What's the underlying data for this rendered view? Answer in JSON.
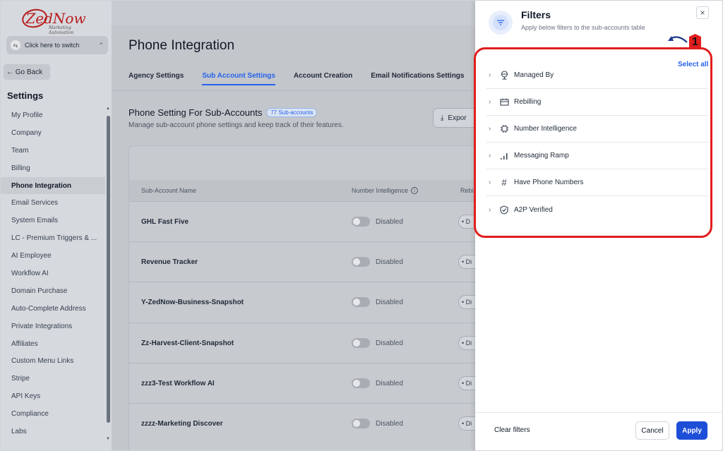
{
  "logo": {
    "name": "ZedNow",
    "tagline": "Marketing Automation"
  },
  "switcher": {
    "label": "Click here to switch"
  },
  "sidebar": {
    "go_back": "← Go Back",
    "settings_title": "Settings",
    "items": [
      {
        "label": "My Profile"
      },
      {
        "label": "Company"
      },
      {
        "label": "Team"
      },
      {
        "label": "Billing"
      },
      {
        "label": "Phone Integration"
      },
      {
        "label": "Email Services"
      },
      {
        "label": "System Emails"
      },
      {
        "label": "LC - Premium Triggers & ..."
      },
      {
        "label": "AI Employee"
      },
      {
        "label": "Workflow AI"
      },
      {
        "label": "Domain Purchase"
      },
      {
        "label": "Auto-Complete Address"
      },
      {
        "label": "Private Integrations"
      },
      {
        "label": "Affiliates"
      },
      {
        "label": "Custom Menu Links"
      },
      {
        "label": "Stripe"
      },
      {
        "label": "API Keys"
      },
      {
        "label": "Compliance"
      },
      {
        "label": "Labs"
      }
    ],
    "active_item": "Phone Integration"
  },
  "main": {
    "title": "Phone Integration",
    "tabs": [
      {
        "label": "Agency Settings"
      },
      {
        "label": "Sub Account Settings"
      },
      {
        "label": "Account Creation"
      },
      {
        "label": "Email Notifications Settings"
      }
    ],
    "active_tab": "Sub Account Settings",
    "section_title": "Phone Setting For Sub-Accounts",
    "badge": "77 Sub-accounts",
    "section_sub": "Manage sub-account phone settings and keep track of their features.",
    "export_label": "Expor",
    "table": {
      "columns": [
        "Sub-Account Name",
        "Number Intelligence",
        "Rebi"
      ],
      "rows": [
        {
          "name": "GHL Fast Five",
          "ni": "Disabled",
          "rb": "• D"
        },
        {
          "name": "Revenue Tracker",
          "ni": "Disabled",
          "rb": "• Di"
        },
        {
          "name": "Y-ZedNow-Business-Snapshot",
          "ni": "Disabled",
          "rb": "• Di"
        },
        {
          "name": "Zz-Harvest-Client-Snapshot",
          "ni": "Disabled",
          "rb": "• Di"
        },
        {
          "name": "zzz3-Test Workflow AI",
          "ni": "Disabled",
          "rb": "• Di"
        },
        {
          "name": "zzzz-Marketing Discover",
          "ni": "Disabled",
          "rb": "• Di"
        }
      ]
    }
  },
  "filters": {
    "title": "Filters",
    "subtitle": "Apply below filters to the sub-accounts table",
    "close": "×",
    "select_all": "Select all",
    "annotation": "1",
    "items": [
      {
        "label": "Managed By",
        "icon": "globe-person-icon"
      },
      {
        "label": "Rebilling",
        "icon": "ticket-icon"
      },
      {
        "label": "Number Intelligence",
        "icon": "chip-icon"
      },
      {
        "label": "Messaging Ramp",
        "icon": "signal-bars-icon"
      },
      {
        "label": "Have Phone Numbers",
        "icon": "hash-icon"
      },
      {
        "label": "A2P Verified",
        "icon": "shield-check-icon"
      }
    ],
    "clear_label": "Clear filters",
    "cancel_label": "Cancel",
    "apply_label": "Apply"
  },
  "colors": {
    "accent": "#2563eb",
    "apply": "#1d4ed8",
    "annotation_red": "#e11d1d",
    "logo_red": "#b71c1c"
  }
}
